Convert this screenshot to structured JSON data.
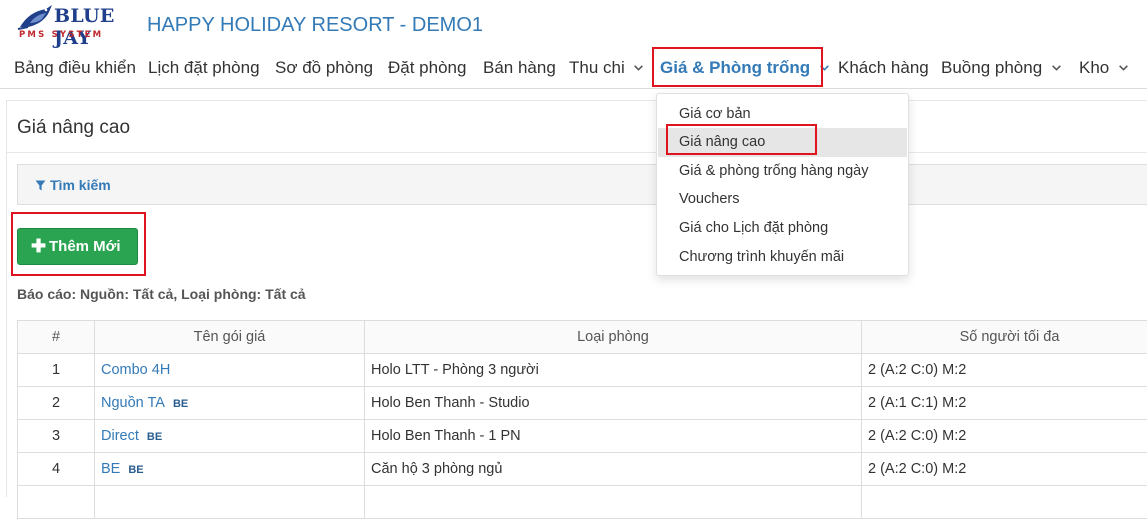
{
  "logo": {
    "brand": "BLUE JAY",
    "subtitle": "PMS SYSTEM"
  },
  "app_title": "HAPPY HOLIDAY RESORT - DEMO1",
  "nav": {
    "items": [
      {
        "label": "Bảng điều khiển",
        "has_dropdown": false
      },
      {
        "label": "Lịch đặt phòng",
        "has_dropdown": false
      },
      {
        "label": "Sơ đồ phòng",
        "has_dropdown": false
      },
      {
        "label": "Đặt phòng",
        "has_dropdown": false
      },
      {
        "label": "Bán hàng",
        "has_dropdown": false
      },
      {
        "label": "Thu chi",
        "has_dropdown": true
      },
      {
        "label": "Giá & Phòng trống",
        "has_dropdown": true,
        "active": true
      },
      {
        "label": "Khách hàng",
        "has_dropdown": false
      },
      {
        "label": "Buồng phòng",
        "has_dropdown": true
      },
      {
        "label": "Kho",
        "has_dropdown": true
      }
    ]
  },
  "dropdown": {
    "items": [
      {
        "label": "Giá cơ bản"
      },
      {
        "label": "Giá nâng cao",
        "selected": true
      },
      {
        "label": "Giá & phòng trống hàng ngày"
      },
      {
        "label": "Vouchers"
      },
      {
        "label": "Giá cho Lịch đặt phòng"
      },
      {
        "label": "Chương trình khuyến mãi"
      }
    ]
  },
  "page": {
    "title": "Giá nâng cao",
    "search_label": "Tìm kiếm",
    "add_button": "Thêm Mới",
    "report": "Báo cáo: Nguồn: Tất cả, Loại phòng: Tất cả"
  },
  "table": {
    "headers": [
      "#",
      "Tên gói giá",
      "Loại phòng",
      "Số người tối đa"
    ],
    "rows": [
      {
        "no": "1",
        "name": "Combo 4H",
        "badge": "",
        "room": "Holo LTT - Phòng 3 người",
        "max": "2 (A:2 C:0) M:2"
      },
      {
        "no": "2",
        "name": "Nguồn TA",
        "badge": "BE",
        "room": "Holo Ben Thanh - Studio",
        "max": "2 (A:1 C:1) M:2"
      },
      {
        "no": "3",
        "name": "Direct",
        "badge": "BE",
        "room": "Holo Ben Thanh - 1 PN",
        "max": "2 (A:2 C:0) M:2"
      },
      {
        "no": "4",
        "name": "BE",
        "badge": "BE",
        "room": "Căn hộ 3 phòng ngủ",
        "max": "2 (A:2 C:0) M:2"
      }
    ]
  },
  "colors": {
    "link": "#337ab7",
    "add_button": "#2aa451",
    "highlight_box": "#e0141e",
    "logo_blue": "#1f3f8a",
    "logo_red": "#c0282e"
  }
}
